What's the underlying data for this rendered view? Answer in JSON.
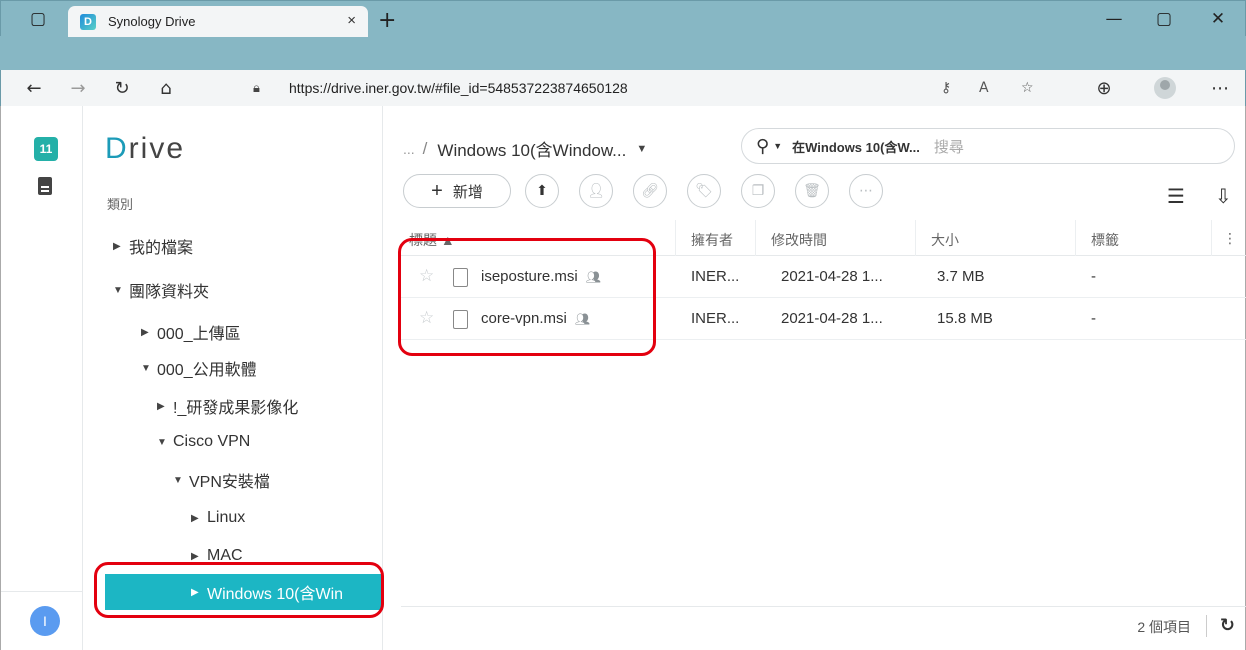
{
  "browser": {
    "tab_title": "Synology Drive",
    "tab_close": "×",
    "new_tab": "+",
    "url": "https://drive.iner.gov.tw/#file_id=548537223874650128"
  },
  "sidebar": {
    "logo_first": "D",
    "logo_rest": "rive",
    "category_label": "類別",
    "notification_count": "11",
    "user_initial": "I",
    "tree": [
      {
        "label": "我的檔案",
        "caret": "▶"
      },
      {
        "label": "團隊資料夾",
        "caret": "▼"
      },
      {
        "label": "000_上傳區",
        "caret": "▶"
      },
      {
        "label": "000_公用軟體",
        "caret": "▼"
      },
      {
        "label": "!_研發成果影像化",
        "caret": "▶"
      },
      {
        "label": "Cisco VPN",
        "caret": "▼"
      },
      {
        "label": "VPN安裝檔",
        "caret": "▼"
      },
      {
        "label": "Linux",
        "caret": "▶"
      },
      {
        "label": "MAC",
        "caret": "▶"
      },
      {
        "label": "Windows 10(含Win",
        "caret": "▶"
      }
    ]
  },
  "main": {
    "breadcrumb_dots": "...",
    "breadcrumb_current": "Windows 10(含Window...",
    "search_scope": "在Windows 10(含W...",
    "search_placeholder": "搜尋",
    "new_button": "新增",
    "columns": {
      "name": "標題 ▲",
      "owner": "擁有者",
      "modified": "修改時間",
      "size": "大小",
      "tags": "標籤",
      "more": "⋮"
    },
    "files": [
      {
        "name": "iseposture.msi",
        "owner": "INER...",
        "modified": "2021-04-28 1...",
        "size": "3.7 MB",
        "tags": "-"
      },
      {
        "name": "core-vpn.msi",
        "owner": "INER...",
        "modified": "2021-04-28 1...",
        "size": "15.8 MB",
        "tags": "-"
      }
    ],
    "item_count": "2 個項目"
  },
  "colors": {
    "accent": "#1cb6c4",
    "annotation": "#e3000f",
    "titlebar": "#87b7c4"
  }
}
